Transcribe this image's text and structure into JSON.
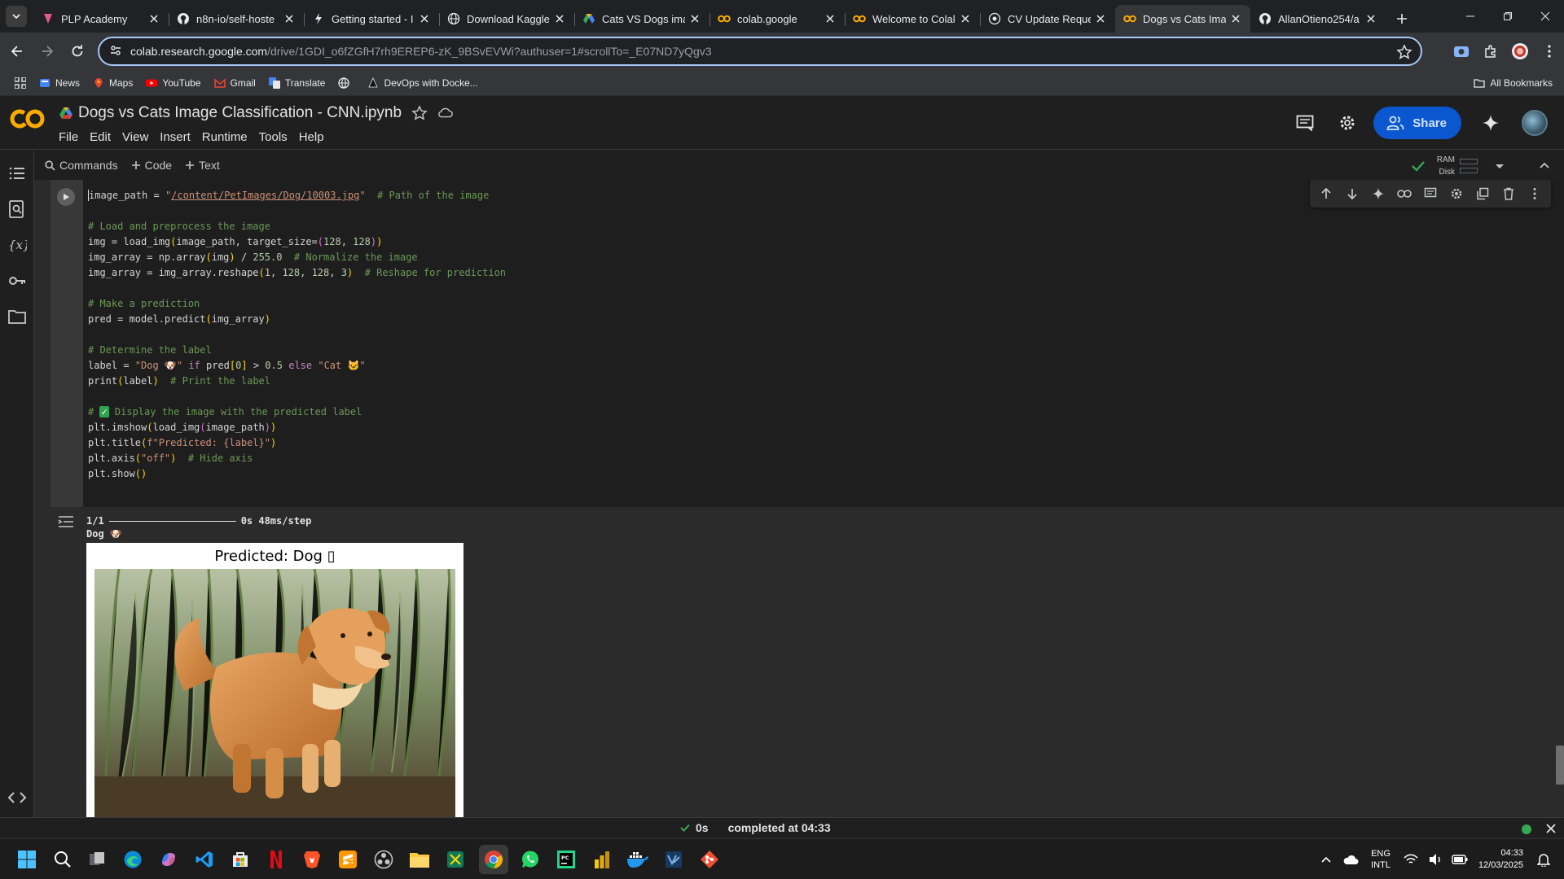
{
  "browser": {
    "tabs": [
      {
        "title": "PLP Academy",
        "icon": "plp-icon"
      },
      {
        "title": "n8n-io/self-hoste",
        "icon": "github-icon"
      },
      {
        "title": "Getting started - I",
        "icon": "bolt-icon"
      },
      {
        "title": "Download Kaggle",
        "icon": "globe-icon"
      },
      {
        "title": "Cats VS Dogs ima",
        "icon": "drive-icon"
      },
      {
        "title": "colab.google",
        "icon": "colab-icon"
      },
      {
        "title": "Welcome to Colal",
        "icon": "colab-icon"
      },
      {
        "title": "CV Update Reque",
        "icon": "globe-icon"
      },
      {
        "title": "Dogs vs Cats Imag",
        "icon": "colab-icon",
        "active": true
      },
      {
        "title": "AllanOtieno254/a",
        "icon": "github-icon"
      }
    ],
    "url_host": "colab.research.google.com",
    "url_path": "/drive/1GDI_o6fZGfH7rh9EREP6-zK_9BSvEVWi?authuser=1#scrollTo=_E07ND7yQgv3",
    "bookmarks": [
      "News",
      "Maps",
      "YouTube",
      "Gmail",
      "Translate",
      "",
      "DevOps with Docke..."
    ],
    "all_bookmarks": "All Bookmarks"
  },
  "colab": {
    "title": "Dogs vs Cats Image Classification - CNN.ipynb",
    "menu": [
      "File",
      "Edit",
      "View",
      "Insert",
      "Runtime",
      "Tools",
      "Help"
    ],
    "share_label": "Share",
    "commands_label": "Commands",
    "add_code_label": "Code",
    "add_text_label": "Text",
    "ram_label": "RAM",
    "disk_label": "Disk"
  },
  "cell": {
    "output_progress": "1/1",
    "output_time": "0s 48ms/step",
    "output_label": "Dog 🐶",
    "figure_title": "Predicted: Dog ▯"
  },
  "status": {
    "time": "0s",
    "message": "completed at 04:33"
  },
  "taskbar": {
    "lang_top": "ENG",
    "lang_bottom": "INTL",
    "time": "04:33",
    "date": "12/03/2025"
  },
  "colors": {
    "accent": "#0b57d0",
    "success": "#34a853",
    "omnibox_border": "#a8c7fa"
  }
}
